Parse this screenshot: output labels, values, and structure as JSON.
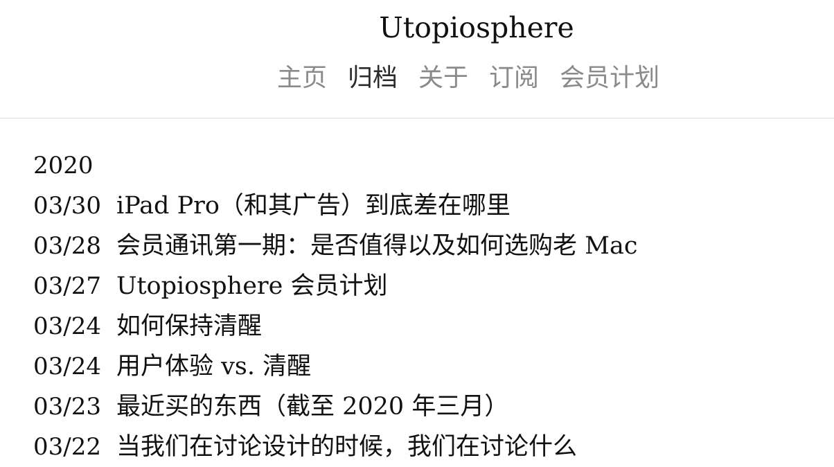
{
  "site": {
    "title": "Utopiosphere"
  },
  "nav": {
    "items": [
      {
        "label": "主页"
      },
      {
        "label": "归档"
      },
      {
        "label": "关于"
      },
      {
        "label": "订阅"
      },
      {
        "label": "会员计划"
      }
    ],
    "active_index": 1
  },
  "archive": {
    "year": "2020",
    "posts": [
      {
        "date": "03/30",
        "title": "iPad Pro（和其广告）到底差在哪里"
      },
      {
        "date": "03/28",
        "title": "会员通讯第一期：是否值得以及如何选购老 Mac"
      },
      {
        "date": "03/27",
        "title": "Utopiosphere 会员计划"
      },
      {
        "date": "03/24",
        "title": "如何保持清醒"
      },
      {
        "date": "03/24",
        "title": "用户体验 vs. 清醒"
      },
      {
        "date": "03/23",
        "title": "最近买的东西（截至 2020 年三月）"
      },
      {
        "date": "03/22",
        "title": "当我们在讨论设计的时候，我们在讨论什么"
      }
    ]
  }
}
